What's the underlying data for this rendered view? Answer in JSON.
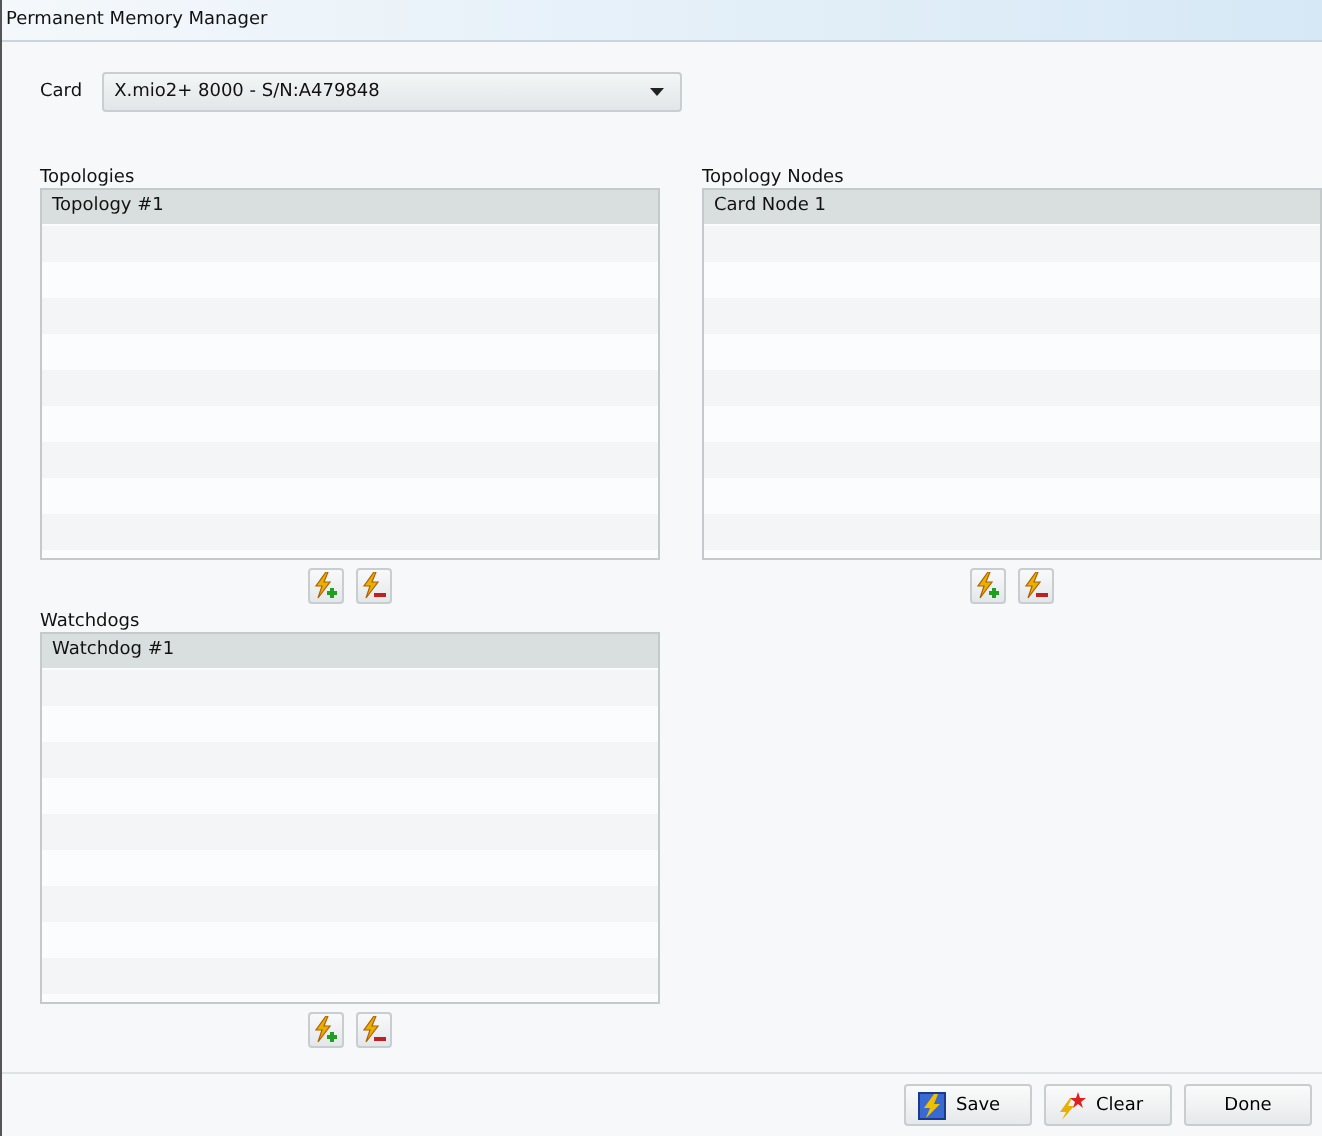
{
  "window": {
    "title": "Permanent Memory Manager"
  },
  "card": {
    "label": "Card",
    "value": "X.mio2+ 8000 - S/N:A479848"
  },
  "panels": [
    {
      "title": "Topologies",
      "items": [
        {
          "label": "Topology #1",
          "selected": true
        }
      ]
    },
    {
      "title": "Topology Nodes",
      "items": [
        {
          "label": "Card Node 1",
          "selected": true
        }
      ]
    },
    {
      "title": "Watchdogs",
      "items": [
        {
          "label": "Watchdog #1",
          "selected": true
        }
      ]
    }
  ],
  "footer_buttons": [
    {
      "kind": "save",
      "label": "Save"
    },
    {
      "kind": "clear",
      "label": "Clear"
    },
    {
      "kind": "done",
      "label": "Done"
    }
  ]
}
